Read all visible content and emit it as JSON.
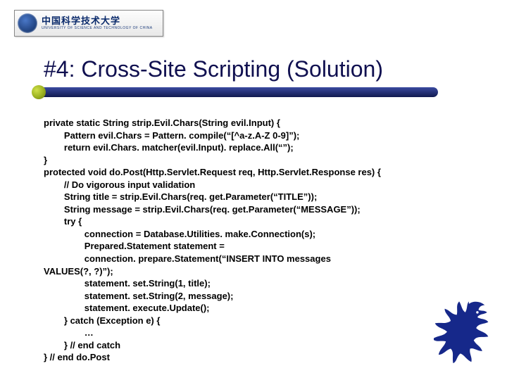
{
  "logo": {
    "cn": "中国科学技术大学",
    "en": "UNIVERSITY OF SCIENCE AND TECHNOLOGY OF CHINA"
  },
  "title": "#4: Cross-Site Scripting (Solution)",
  "code": "private static String strip.Evil.Chars(String evil.Input) {\n        Pattern evil.Chars = Pattern. compile(“[^a-z.A-Z 0-9]”);\n        return evil.Chars. matcher(evil.Input). replace.All(“”);\n}\nprotected void do.Post(Http.Servlet.Request req, Http.Servlet.Response res) {\n        // Do vigorous input validation\n        String title = strip.Evil.Chars(req. get.Parameter(“TITLE”));\n        String message = strip.Evil.Chars(req. get.Parameter(“MESSAGE”));\n        try {\n                connection = Database.Utilities. make.Connection(s);\n                Prepared.Statement statement =\n                connection. prepare.Statement(“INSERT INTO messages\nVALUES(?, ?)”);\n                statement. set.String(1, title);\n                statement. set.String(2, message);\n                statement. execute.Update();\n        } catch (Exception e) {\n                …\n        } // end catch\n} // end do.Post"
}
